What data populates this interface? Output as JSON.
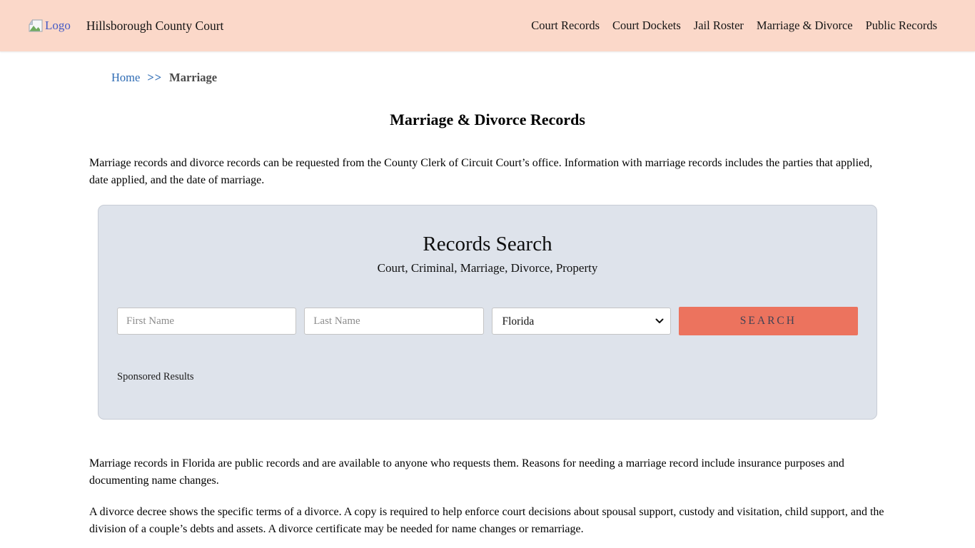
{
  "colors": {
    "header-bg": "#fbd8c9",
    "accent": "#ec735e",
    "panel-bg": "#dee3eb",
    "link": "#2d6bb4",
    "logo-link": "#4459c5",
    "button-text": "#3f4254"
  },
  "header": {
    "logo_alt": "Logo",
    "site_title": "Hillsborough County Court",
    "nav": [
      "Court Records",
      "Court Dockets",
      "Jail Roster",
      "Marriage & Divorce",
      "Public Records"
    ]
  },
  "breadcrumb": {
    "home": "Home",
    "separator": ">>",
    "current": "Marriage"
  },
  "page": {
    "title": "Marriage & Divorce Records",
    "intro": "Marriage records and divorce records can be requested from the County Clerk of Circuit Court’s office. Information with marriage records includes the parties that applied, date applied, and the date of marriage.",
    "para_public": "Marriage records in Florida are public records and are available to anyone who requests them. Reasons for needing a marriage record include insurance purposes and documenting name changes.",
    "para_divorce": "A divorce decree shows the specific terms of a divorce. A copy is required to help enforce court decisions about spousal support, custody and visitation, child support, and the division of a couple’s debts and assets. A divorce certificate may be needed for name changes or remarriage."
  },
  "search": {
    "title": "Records Search",
    "subtitle": "Court, Criminal, Marriage, Divorce, Property",
    "first_name_placeholder": "First Name",
    "last_name_placeholder": "Last Name",
    "state_selected": "Florida",
    "button_label": "SEARCH",
    "sponsored_label": "Sponsored Results"
  }
}
